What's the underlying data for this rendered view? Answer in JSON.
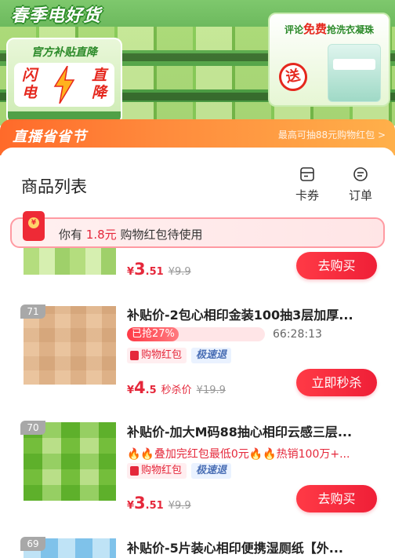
{
  "banner": {
    "season_title": "春季电好货",
    "left_card": {
      "official": "官方补贴直降",
      "flash_left": "闪电",
      "flash_right": "直降"
    },
    "right_card": {
      "review_prefix": "评论",
      "review_free": "免费",
      "review_suffix": "抢洗衣凝珠",
      "gift_char": "送"
    }
  },
  "live": {
    "title": "直播省省节",
    "note": "最高可抽88元购物红包 >"
  },
  "sheet": {
    "title": "商品列表",
    "actions": {
      "coupon": "卡券",
      "orders": "订单"
    }
  },
  "notice": {
    "prefix": "你有",
    "amount": "1.8元",
    "suffix": "购物红包待使用"
  },
  "items": [
    {
      "price_cur": "¥",
      "price_int": "3",
      "price_dec": ".51",
      "orig": "¥9.9",
      "button": "去购买"
    },
    {
      "rank": "71",
      "title": "补贴价-2包心相印金装100抽3层加厚...",
      "progress_label": "已抢27%",
      "progress": 0.27,
      "countdown": "66:28:13",
      "tag_red": "购物红包",
      "tag_blue": "极速退",
      "price_cur": "¥",
      "price_int": "4",
      "price_dec": ".5",
      "seckill": "秒杀价",
      "orig": "¥19.9",
      "button": "立即秒杀"
    },
    {
      "rank": "70",
      "title": "补贴价-加大M码88抽心相印云感三层...",
      "hot_line": "🔥🔥叠加完红包最低0元🔥🔥热销100万+...",
      "tag_red": "购物红包",
      "tag_blue": "极速退",
      "price_cur": "¥",
      "price_int": "3",
      "price_dec": ".51",
      "orig": "¥9.9",
      "button": "去购买"
    },
    {
      "rank": "69",
      "title": "补贴价-5片装心相印便携湿厕纸【外..."
    }
  ],
  "colors": {
    "accent_red": "#e5283b",
    "live_orange": "#ff7a30",
    "banner_green": "#5aa94c"
  }
}
